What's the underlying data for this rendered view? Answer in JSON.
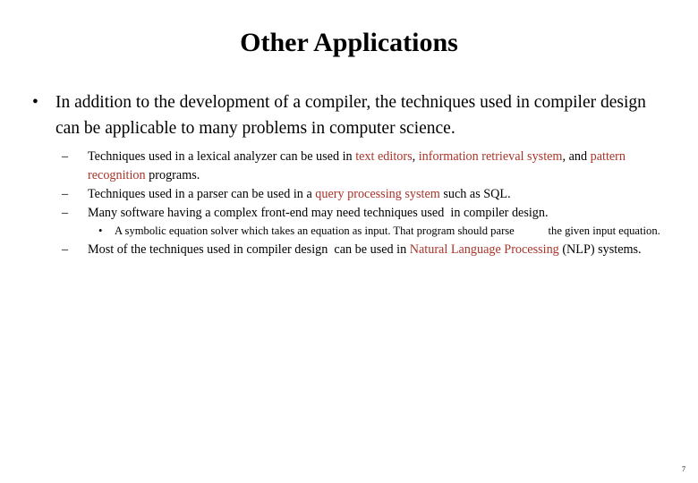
{
  "slide": {
    "title": "Other Applications",
    "page_number": "7",
    "accent_color": "#a8342a",
    "background_color": "#ffffff",
    "text_color": "#000000"
  },
  "bullets": {
    "level1": {
      "marker": "•",
      "text": "In addition to the development of a compiler, the techniques used in compiler design can be applicable to many problems in computer science."
    },
    "level2_a": {
      "marker": "–",
      "seg1": "Techniques used in a lexical analyzer can be used in ",
      "seg2_highlight": "text editors",
      "seg3": ", ",
      "seg4_highlight": "information retrieval system",
      "seg5": ", and ",
      "seg6_highlight": "pattern recognition",
      "seg7": " programs."
    },
    "level2_b": {
      "marker": "–",
      "seg1": "Techniques used in a parser can be used in a ",
      "seg2_highlight": "query processing system",
      "seg3": " such as SQL."
    },
    "level2_c": {
      "marker": "–",
      "text": "Many software having a complex front-end may need techniques used  in compiler design."
    },
    "level3_a": {
      "marker": "•",
      "seg1": "A symbolic equation solver which takes an equation as input. That program should parse",
      "gap": "            ",
      "seg2": "the given input equation."
    },
    "level2_d": {
      "marker": "–",
      "seg1": "Most of the techniques used in compiler design  can be used in ",
      "seg2_highlight": "Natural Language Processing",
      "seg3": " (NLP) systems."
    }
  }
}
